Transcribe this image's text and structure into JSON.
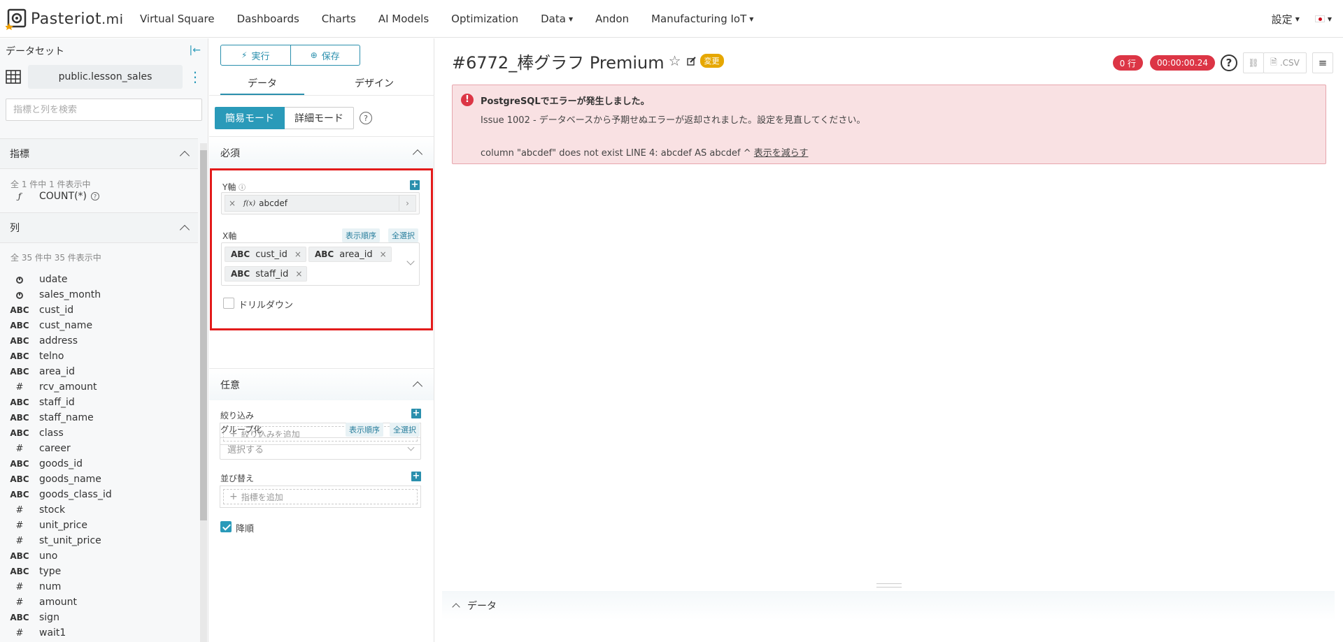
{
  "nav": {
    "brand_main": "Pasteriot",
    "brand_suffix": ".mi",
    "items": [
      {
        "label": "Virtual Square"
      },
      {
        "label": "Dashboards"
      },
      {
        "label": "Charts"
      },
      {
        "label": "AI Models"
      },
      {
        "label": "Optimization"
      },
      {
        "label": "Data"
      },
      {
        "label": "Andon"
      },
      {
        "label": "Manufacturing IoT"
      }
    ],
    "settings_label": "設定"
  },
  "sidebar": {
    "header": "データセット",
    "dataset": "public.lesson_sales",
    "search_placeholder": "指標と列を検索",
    "metrics_title": "指標",
    "metrics_count": "全 1 件中 1 件表示中",
    "metrics": [
      {
        "type": "ƒ",
        "name": "COUNT(*)"
      }
    ],
    "columns_title": "列",
    "columns_count": "全 35 件中 35 件表示中",
    "columns": [
      {
        "type": "time",
        "name": "udate"
      },
      {
        "type": "time",
        "name": "sales_month"
      },
      {
        "type": "ABC",
        "name": "cust_id"
      },
      {
        "type": "ABC",
        "name": "cust_name"
      },
      {
        "type": "ABC",
        "name": "address"
      },
      {
        "type": "ABC",
        "name": "telno"
      },
      {
        "type": "ABC",
        "name": "area_id"
      },
      {
        "type": "#",
        "name": "rcv_amount"
      },
      {
        "type": "ABC",
        "name": "staff_id"
      },
      {
        "type": "ABC",
        "name": "staff_name"
      },
      {
        "type": "ABC",
        "name": "class"
      },
      {
        "type": "#",
        "name": "career"
      },
      {
        "type": "ABC",
        "name": "goods_id"
      },
      {
        "type": "ABC",
        "name": "goods_name"
      },
      {
        "type": "ABC",
        "name": "goods_class_id"
      },
      {
        "type": "#",
        "name": "stock"
      },
      {
        "type": "#",
        "name": "unit_price"
      },
      {
        "type": "#",
        "name": "st_unit_price"
      },
      {
        "type": "ABC",
        "name": "uno"
      },
      {
        "type": "ABC",
        "name": "type"
      },
      {
        "type": "#",
        "name": "num"
      },
      {
        "type": "#",
        "name": "amount"
      },
      {
        "type": "ABC",
        "name": "sign"
      },
      {
        "type": "#",
        "name": "wait1"
      }
    ]
  },
  "panel": {
    "run_label": "実行",
    "save_label": "保存",
    "tab_data": "データ",
    "tab_design": "デザイン",
    "mode_simple": "簡易モード",
    "mode_detail": "詳細モード",
    "required_title": "必須",
    "y_axis_label": "Y軸",
    "y_metric": "abcdef",
    "x_axis_label": "X軸",
    "order_label": "表示順序",
    "select_all_label": "全選択",
    "x_chips": [
      "cust_id",
      "area_id",
      "staff_id"
    ],
    "chip_type": "ABC",
    "drilldown_label": "ドリルダウン",
    "optional_title": "任意",
    "filter_label": "絞り込み",
    "filter_add": "絞り込みを追加",
    "group_label": "グループ化",
    "group_placeholder": "選択する",
    "sort_label": "並び替え",
    "sort_add": "指標を追加",
    "desc_label": "降順"
  },
  "main": {
    "title": "#6772_棒グラフ Premium",
    "changed_badge": "変更",
    "rows_pill": "0 行",
    "time_pill": "00:00:00.24",
    "csv_label": ".CSV",
    "error_title": "PostgreSQLでエラーが発生しました。",
    "error_line1": "Issue 1002 - データベースから予期せぬエラーが返却されました。設定を見直してください。",
    "error_line2": "column \"abcdef\" does not exist LINE 4: abcdef AS abcdef ^",
    "error_link": "表示を減らす",
    "data_section": "データ"
  },
  "colors": {
    "accent": "#2a9ab9",
    "danger": "#dc3545",
    "highlight": "#e31b1b",
    "badge": "#e6a700"
  }
}
